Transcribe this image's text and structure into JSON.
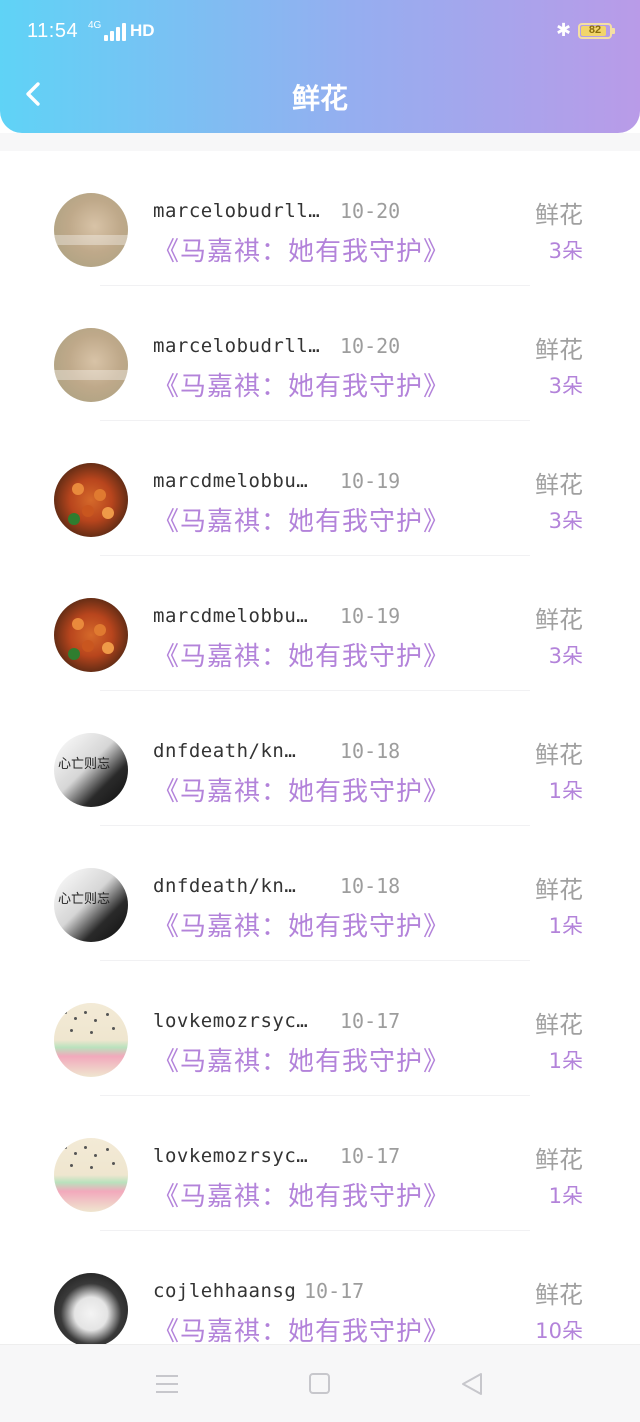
{
  "status_bar": {
    "time": "11:54",
    "network": "4G",
    "hd": "HD",
    "bluetooth_icon": "bluetooth-icon",
    "battery_level": "82"
  },
  "header": {
    "title": "鲜花",
    "back_icon": "chevron-left-icon"
  },
  "colors": {
    "header_gradient_start": "#5fd3f6",
    "header_gradient_end": "#b99be8",
    "accent_purple": "#b383da",
    "muted_gray": "#9d9d9d"
  },
  "list": {
    "items": [
      {
        "name": "marcelobudrll…",
        "date": "10-20",
        "book": "《马嘉祺：她有我守护》",
        "gift": "鲜花",
        "count": "3朵",
        "avatar": "blurred-photo"
      },
      {
        "name": "marcelobudrll…",
        "date": "10-20",
        "book": "《马嘉祺：她有我守护》",
        "gift": "鲜花",
        "count": "3朵",
        "avatar": "blurred-photo"
      },
      {
        "name": "marcdmelobbu…",
        "date": "10-19",
        "book": "《马嘉祺：她有我守护》",
        "gift": "鲜花",
        "count": "3朵",
        "avatar": "food-photo"
      },
      {
        "name": "marcdmelobbu…",
        "date": "10-19",
        "book": "《马嘉祺：她有我守护》",
        "gift": "鲜花",
        "count": "3朵",
        "avatar": "food-photo"
      },
      {
        "name": "dnfdeath/kn…",
        "date": "10-18",
        "book": "《马嘉祺：她有我守护》",
        "gift": "鲜花",
        "count": "1朵",
        "avatar": "bw-portrait",
        "avatar_text": "心亡则忘"
      },
      {
        "name": "dnfdeath/kn…",
        "date": "10-18",
        "book": "《马嘉祺：她有我守护》",
        "gift": "鲜花",
        "count": "1朵",
        "avatar": "bw-portrait",
        "avatar_text": "心亡则忘"
      },
      {
        "name": "lovkemozrsyc…",
        "date": "10-17",
        "book": "《马嘉祺：她有我守护》",
        "gift": "鲜花",
        "count": "1朵",
        "avatar": "phone-case-photo"
      },
      {
        "name": "lovkemozrsyc…",
        "date": "10-17",
        "book": "《马嘉祺：她有我守护》",
        "gift": "鲜花",
        "count": "1朵",
        "avatar": "phone-case-photo"
      },
      {
        "name": "cojlehhaansg",
        "date": "10-17",
        "book": "《马嘉祺：她有我守护》",
        "gift": "鲜花",
        "count": "10朵",
        "avatar": "person-photo"
      }
    ]
  },
  "navbar": {
    "menu_icon": "menu-icon",
    "home_icon": "home-square-icon",
    "back_icon": "back-triangle-icon"
  }
}
